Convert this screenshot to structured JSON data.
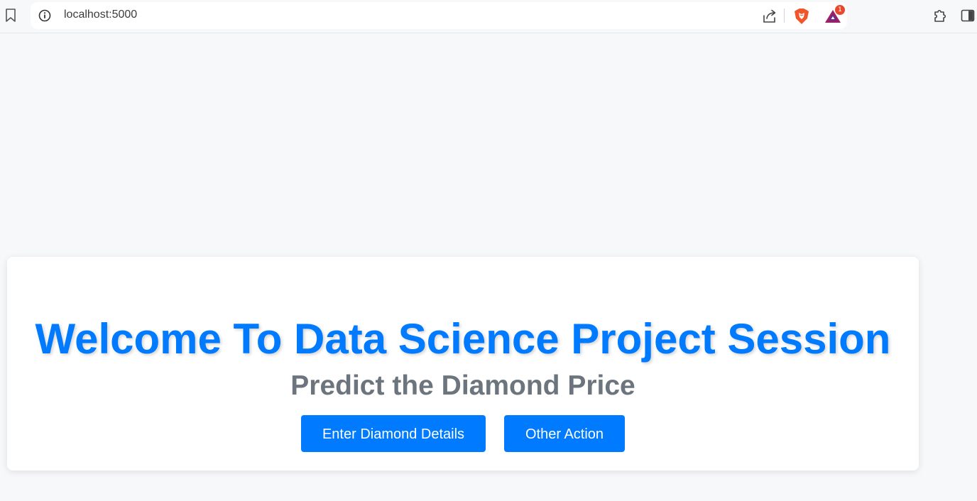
{
  "browser": {
    "url": "localhost:5000",
    "rewards_badge_count": "1",
    "icons": {
      "bookmark": "bookmark-icon",
      "info": "info-icon",
      "share": "share-icon",
      "brave": "brave-shields-icon",
      "rewards": "brave-rewards-icon",
      "extensions": "extensions-icon",
      "sidebar": "sidebar-icon"
    }
  },
  "main": {
    "title": "Welcome To Data Science Project Session",
    "subtitle": "Predict the Diamond Price",
    "buttons": [
      {
        "label": "Enter Diamond Details"
      },
      {
        "label": "Other Action"
      }
    ]
  },
  "colors": {
    "accent": "#007bff",
    "subtitle": "#6c757d",
    "page_background": "#f7f8fa",
    "card_background": "#ffffff"
  }
}
